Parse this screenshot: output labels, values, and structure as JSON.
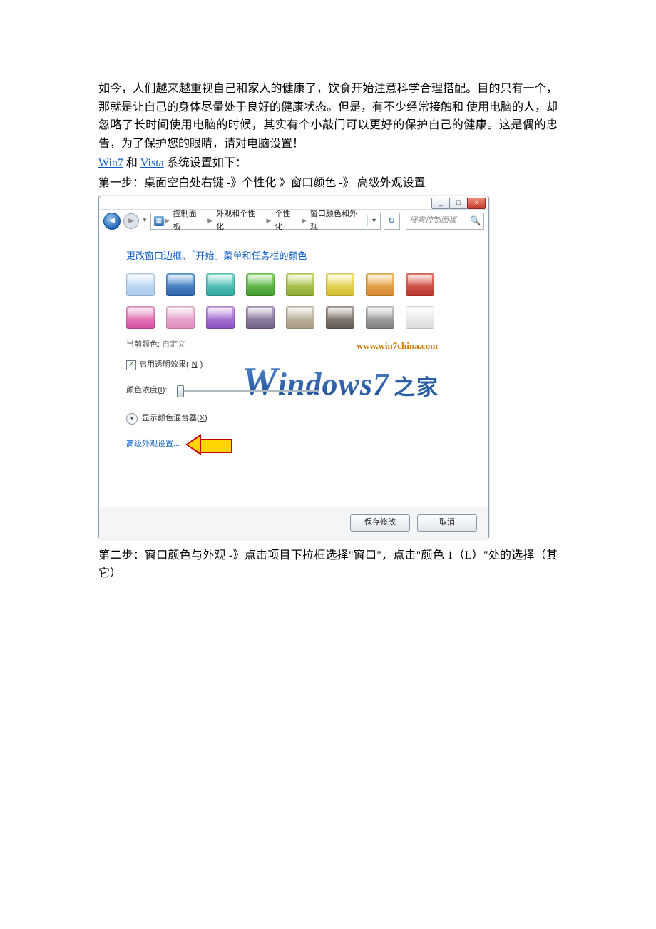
{
  "article": {
    "p1": "如今，人们越来越重视自己和家人的健康了，饮食开始注意科学合理搭配。目的只有一个，那就是让自己的身体尽量处于良好的健康状态。但是，有不少经常接触和  使用电脑的人，却忽略了长时间使用电脑的时候，其实有个小敲门可以更好的保护自己的健康。这是偶的忠告，为了保护您的眼睛，请对电脑设置！",
    "link1": "Win7",
    "mid1": " 和 ",
    "link2": "Vista",
    "tail1": " 系统设置如下：",
    "step1": "第一步：桌面空白处右键 -》个性化 》窗口颜色 -》 高级外观设置",
    "step2": "第二步：窗口颜色与外观 -》点击项目下拉框选择\"窗口\"，点击\"颜色 1（L）\"处的选择（其它）"
  },
  "window": {
    "title_min": "_",
    "title_max": "□",
    "title_close": "×",
    "breadcrumb": {
      "items": [
        "控制面板",
        "外观和个性化",
        "个性化",
        "窗口颜色和外观"
      ]
    },
    "search_placeholder": "搜索控制面板",
    "section_title": "更改窗口边框、「开始」菜单和任务栏的颜色",
    "current_color_label": "当前颜色:",
    "current_color_value": "自定义",
    "enable_trans_pre": "启用透明效果(",
    "enable_trans_u": "N",
    "enable_trans_post": ")",
    "intensity_pre": "颜色浓度(",
    "intensity_u": "I",
    "intensity_post": ":",
    "mixer_pre": "显示颜色混合器(",
    "mixer_u": "X",
    "mixer_post": ")",
    "adv_link": "高级外观设置...",
    "logo_url": "www.win7china.com",
    "logo_main_w": "W",
    "logo_main_rest": "indows7",
    "logo_zh": "之家",
    "btn_save": "保存修改",
    "btn_cancel": "取消"
  }
}
